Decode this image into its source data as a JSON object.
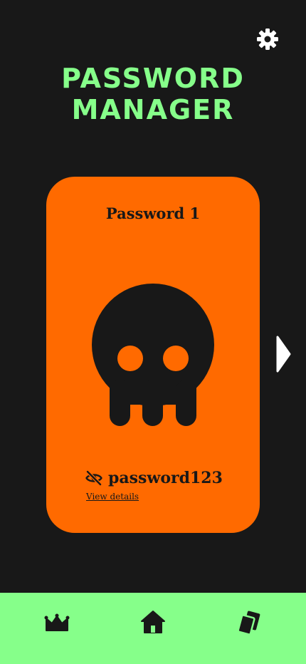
{
  "header": {
    "title_line1": "PASSWORD",
    "title_line2": "MANAGER",
    "settings_icon": "gear-icon"
  },
  "card": {
    "title": "Password 1",
    "image_icon": "skull-icon",
    "visibility_icon": "eye-off-icon",
    "password": "password123",
    "details_link": "View details"
  },
  "pager": {
    "next_icon": "chevron-right-icon"
  },
  "nav": {
    "items": [
      {
        "icon": "crown-icon"
      },
      {
        "icon": "home-icon"
      },
      {
        "icon": "cards-icon"
      }
    ]
  },
  "colors": {
    "background": "#181818",
    "accent": "#86ff8a",
    "card": "#ff6a00",
    "text_dark": "#181818",
    "white": "#ffffff"
  }
}
